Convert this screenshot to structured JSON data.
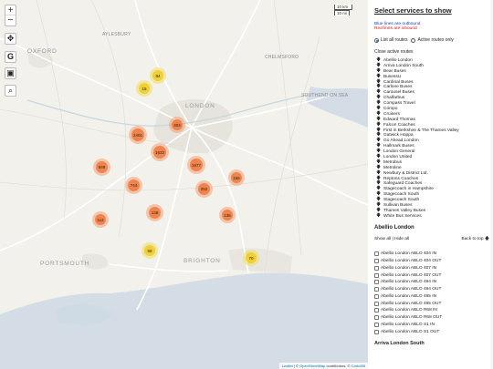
{
  "map": {
    "controls": {
      "zoom_in": "+",
      "zoom_out": "−",
      "locate": "✥",
      "g": "G",
      "bus": "▣",
      "search": "⌕"
    },
    "scale": {
      "km": "10 km",
      "mi": "10 mi"
    },
    "places": {
      "oxford": "OXFORD",
      "aylesbury": "AYLESBURY",
      "london": "LONDON",
      "portsmouth": "PORTSMOUTH",
      "brighton": "BRIGHTON",
      "southend": "SOUTHEND ON SEA",
      "chelmsford": "CHELMSFORD"
    },
    "clusters": [
      {
        "label": "84",
        "color": "yellow"
      },
      {
        "label": "15",
        "color": "yellow"
      },
      {
        "label": "404",
        "color": "orange"
      },
      {
        "label": "2401",
        "color": "orange"
      },
      {
        "label": "1632",
        "color": "orange"
      },
      {
        "label": "1677",
        "color": "orange"
      },
      {
        "label": "849",
        "color": "orange"
      },
      {
        "label": "744",
        "color": "orange"
      },
      {
        "label": "165",
        "color": "orange"
      },
      {
        "label": "252",
        "color": "orange"
      },
      {
        "label": "136",
        "color": "orange"
      },
      {
        "label": "136",
        "color": "orange"
      },
      {
        "label": "112",
        "color": "orange"
      },
      {
        "label": "68",
        "color": "yellow"
      },
      {
        "label": "70",
        "color": "yellow"
      }
    ],
    "attribution": {
      "leaflet": "Leaflet",
      "sep": " | © ",
      "osm": "OpenStreetMap",
      "contrib": " contributors, © ",
      "carto": "CartoDB"
    }
  },
  "panel": {
    "title": "Select services to show",
    "legend_outbound": "Blue lines are outbound",
    "legend_inbound": "Red lines are inbound",
    "radio_all": "List all routes",
    "radio_active": "Active routes only",
    "close_active": "Close active routes",
    "operators": [
      "Abellio London",
      "Arriva London South",
      "Bear Buses",
      "BusessU",
      "Cardinal Buses",
      "Carlone Buses",
      "Carousel Buses",
      "Chalfarbus",
      "Compass Travel",
      "Compo",
      "Cruisers",
      "Edward Thomas",
      "Falcon Coaches",
      "First in Berkshire & The Thames Valley",
      "Gatwick Hoppa",
      "Go Ahead London",
      "Hallmark Buses",
      "London General",
      "London United",
      "Metrobus",
      "Metroline",
      "Newbury & District Ltd.",
      "Reptons Coaches",
      "Safeguard Coaches",
      "Stagecoach in Hampshire",
      "Stagecoach South",
      "Stagecoach South",
      "Sullivan Buses",
      "Thames Valley Buses",
      "White Bus Services"
    ],
    "section": {
      "heading": "Abellio London",
      "show_all": "Show all",
      "sep": " | ",
      "hide_all": "Hide all",
      "back_to_top": "Back to top",
      "routes": [
        "Abellio London ABLO 404 IN",
        "Abellio London ABLO 404 OUT",
        "Abellio London ABLO 407 IN",
        "Abellio London ABLO 407 OUT",
        "Abellio London ABLO 464 IN",
        "Abellio London ABLO 464 OUT",
        "Abellio London ABLO 465 IN",
        "Abellio London ABLO 465 OUT",
        "Abellio London ABLO R68 IN",
        "Abellio London ABLO R68 OUT",
        "Abellio London ABLO S1 IN",
        "Abellio London ABLO S1 OUT"
      ]
    },
    "next_heading": "Arriva London South"
  },
  "colors": {
    "outbound": "#1a3cc8",
    "inbound": "#d32020",
    "cluster_orange": "#f0783c",
    "cluster_yellow": "#f0cd28"
  }
}
